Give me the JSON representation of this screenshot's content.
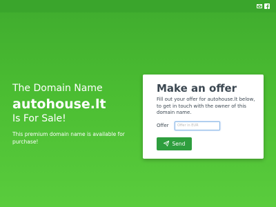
{
  "header": {
    "icons": [
      "envelope-icon",
      "facebook-icon"
    ]
  },
  "hero": {
    "line1": "The Domain Name",
    "domain": "autohouse.lt",
    "line3": "Is For Sale!",
    "description": "This premium domain name is available for purchase!"
  },
  "offer_form": {
    "title": "Make an offer",
    "text": "Fill out your offer for autohouse.lt below, to get in touch with the owner of this domain name.",
    "offer_label": "Offer",
    "offer_value": "",
    "offer_placeholder": "Offer in EUR",
    "send_label": "Send",
    "send_icon": "paper-plane-icon"
  },
  "colors": {
    "background": "#4bbd32",
    "topbar": "#3aa52c",
    "button": "#2e9e3e",
    "card": "#ffffff",
    "title_text": "#3b4751"
  }
}
